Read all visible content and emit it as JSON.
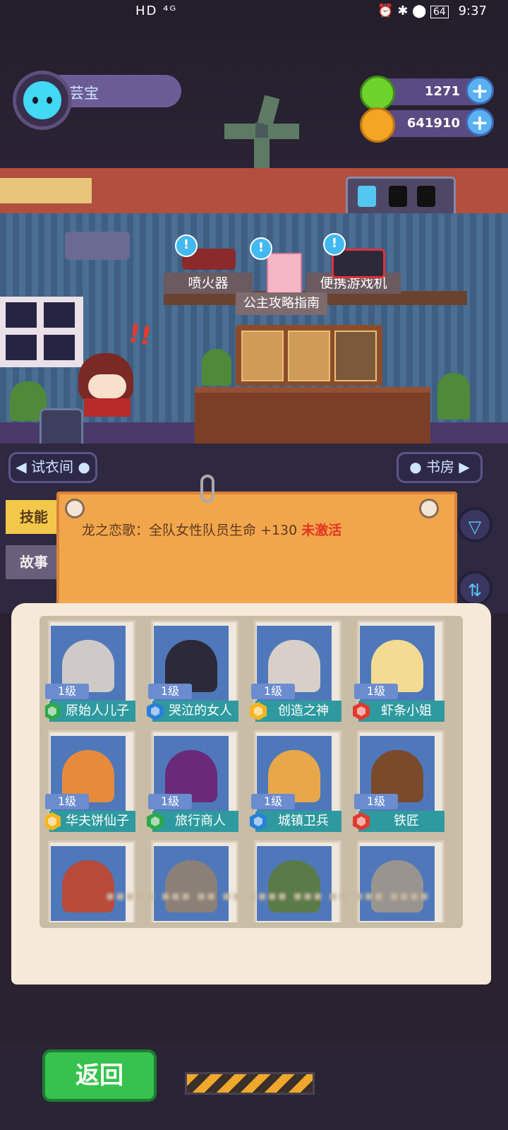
{
  "status_bar": {
    "left": "HD ⁴ᴳ",
    "time": "9:37",
    "battery": "64"
  },
  "player": {
    "name": "芸宝"
  },
  "currencies": [
    {
      "icon": "green-gem-icon",
      "amount": "1271",
      "color": "#6ed22c"
    },
    {
      "icon": "gold-planet-coin-icon",
      "amount": "641910",
      "color": "#f5a524"
    }
  ],
  "room": {
    "items": [
      {
        "label": "喷火器",
        "badge": "!"
      },
      {
        "label": "公主攻略指南",
        "badge": "!"
      },
      {
        "label": "便携游戏机",
        "badge": "!"
      }
    ],
    "alert": "!!"
  },
  "nav": {
    "left": "试衣间",
    "right": "书房"
  },
  "side_tabs": {
    "skill": "技能",
    "story": "故事"
  },
  "notice": {
    "text": "龙之恋歌：全队女性队员生命 +130",
    "status": "未激活"
  },
  "buttons": {
    "filter_icon": "filter-icon",
    "sort_icon": "sort-icon"
  },
  "cards": [
    {
      "level": "1级",
      "name": "原始人儿子",
      "badge_color": "#2ea84a",
      "hair": "#cfcac8"
    },
    {
      "level": "1级",
      "name": "哭泣的女人",
      "badge_color": "#2a7fd9",
      "hair": "#2c2a3a"
    },
    {
      "level": "1级",
      "name": "创造之神",
      "badge_color": "#f5b51c",
      "hair": "#d8d0c8"
    },
    {
      "level": "1级",
      "name": "虾条小姐",
      "badge_color": "#e03a2e",
      "hair": "#f3dc92"
    },
    {
      "level": "1级",
      "name": "华夫饼仙子",
      "badge_color": "#f5b51c",
      "hair": "#e88a3c"
    },
    {
      "level": "1级",
      "name": "旅行商人",
      "badge_color": "#2ea84a",
      "hair": "#6a2a7a"
    },
    {
      "level": "1级",
      "name": "城镇卫兵",
      "badge_color": "#2a7fd9",
      "hair": "#e8a84a"
    },
    {
      "level": "1级",
      "name": "铁匠",
      "badge_color": "#e03a2e",
      "hair": "#7a4a2a"
    },
    {
      "level": "",
      "name": "",
      "badge_color": "#888888",
      "hair": "#b84a3a"
    },
    {
      "level": "",
      "name": "",
      "badge_color": "#888888",
      "hair": "#8a8078"
    },
    {
      "level": "",
      "name": "",
      "badge_color": "#888888",
      "hair": "#5a7a4a"
    },
    {
      "level": "",
      "name": "",
      "badge_color": "#888888",
      "hair": "#9a9490"
    }
  ],
  "footer": {
    "back": "返回"
  }
}
